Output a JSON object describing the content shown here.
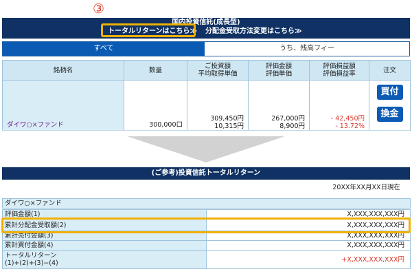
{
  "step_marker": "③",
  "top_panel": {
    "title": "国内投資信託(成長型)",
    "total_return_link": "トータルリターンはこちら≫",
    "distribution_link": "分配金受取方法変更はこちら≫",
    "tabs": [
      "すべて",
      "うち、残高フィー"
    ],
    "columns": {
      "name": "銘柄名",
      "quantity": "数量",
      "cost_l1": "ご投資額",
      "cost_l2": "平均取得単価",
      "valuation_l1": "評価金額",
      "valuation_l2": "評価単価",
      "pl_l1": "評価損益額",
      "pl_l2": "評価損益率",
      "order": "注文"
    },
    "row": {
      "fund_name": "ダイワ○×ファンド",
      "quantity": "300,000口",
      "investment": "309,450円",
      "avg_cost": "10,315円",
      "valuation": "267,000円",
      "unit_price": "8,900円",
      "pl_amount": "- 42,450円",
      "pl_rate": "- 13.72%",
      "buy_label": "買付",
      "sell_label": "換金"
    }
  },
  "bottom_panel": {
    "title": "(ご参考)投資信託トータルリターン",
    "as_of": "20XX年XX月XX日現在",
    "fund_name": "ダイワ○×ファンド",
    "rows": [
      {
        "label": "評価金額(1)",
        "value": "X,XXX,XXX,XXX円"
      },
      {
        "label": "累計分配金受取額(2)",
        "value": "X,XXX,XXX,XXX円"
      },
      {
        "label": "累計売付金額(3)",
        "value": "X,XXX,XXX,XXX円"
      },
      {
        "label": "累計買付金額(4)",
        "value": "X,XXX,XXX,XXX円"
      }
    ],
    "total": {
      "label_l1": "トータルリターン",
      "label_l2": "(1)+(2)+(3)−(4)",
      "value": "+X,XXX,XXX,XXX円"
    }
  },
  "colors": {
    "header_navy": "#0f3163",
    "tab_active": "#0b5bb5",
    "highlight": "#f0b000",
    "cell_light_blue": "#d9edf6",
    "negative_red": "#d8392b"
  }
}
